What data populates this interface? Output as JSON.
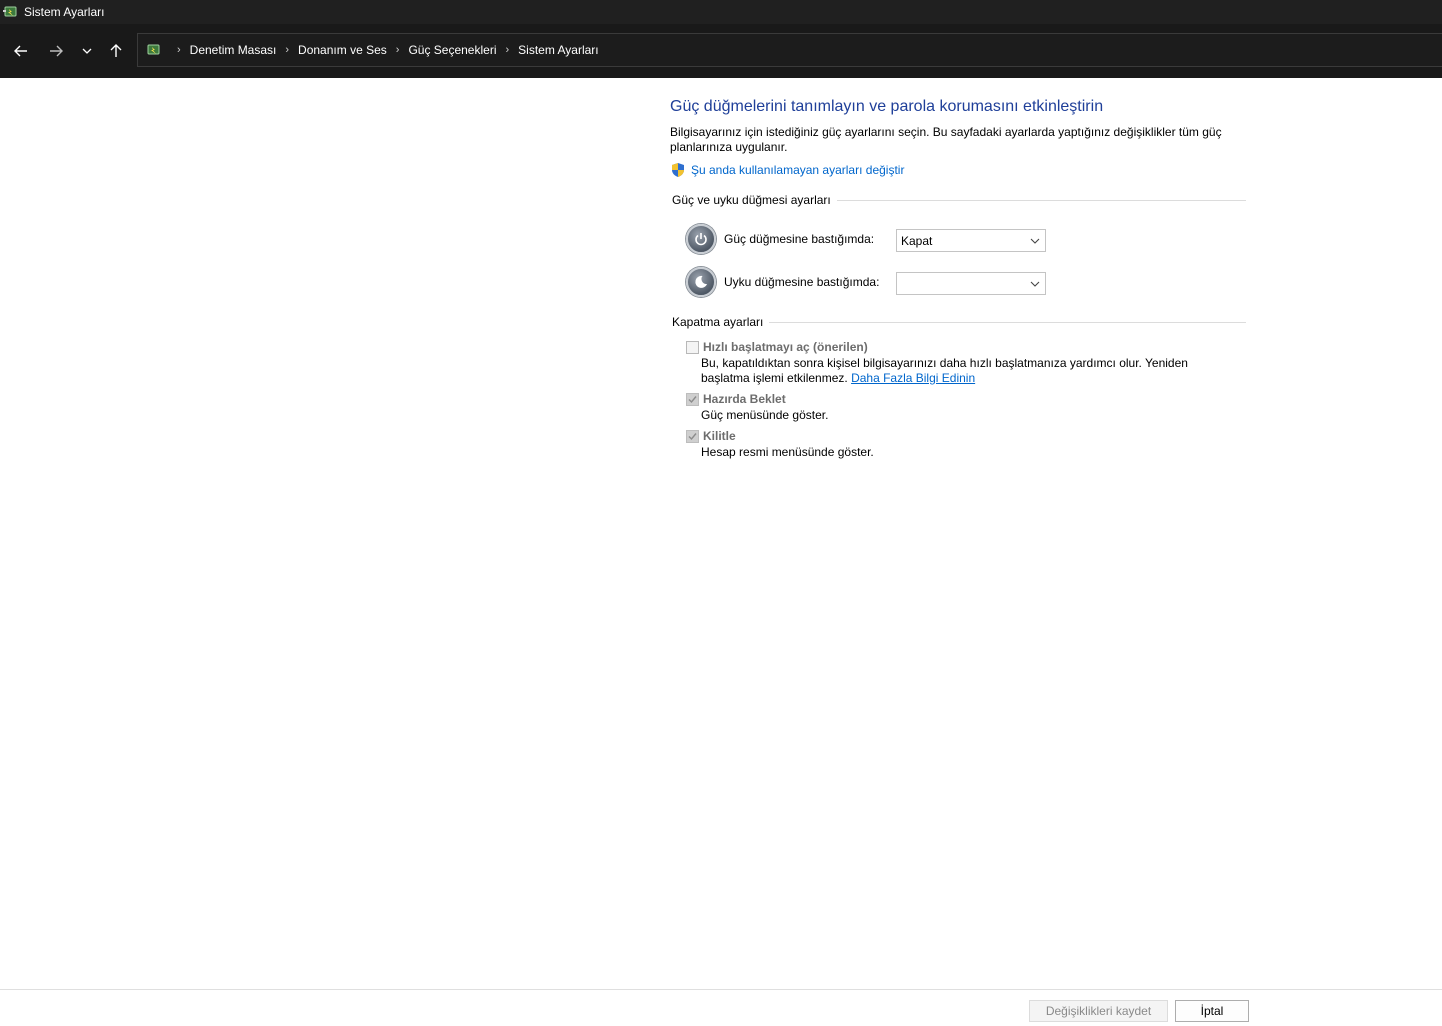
{
  "window": {
    "title": "Sistem Ayarları",
    "icon": "power-options-icon"
  },
  "nav": {
    "back_icon": "arrow-left-icon",
    "forward_icon": "arrow-right-icon",
    "recent_icon": "chevron-down-icon",
    "up_icon": "arrow-up-icon",
    "breadcrumbs": [
      "Denetim Masası",
      "Donanım ve Ses",
      "Güç Seçenekleri",
      "Sistem Ayarları"
    ]
  },
  "main": {
    "title": "Güç düğmelerini tanımlayın ve parola korumasını etkinleştirin",
    "description": "Bilgisayarınız için istediğiniz güç ayarlarını seçin. Bu sayfadaki ayarlarda yaptığınız değişiklikler tüm güç planlarınıza uygulanır.",
    "change_link": "Şu anda kullanılamayan ayarları değiştir",
    "power_group": {
      "header": "Güç ve uyku düğmesi ayarları",
      "power_button_label": "Güç düğmesine bastığımda:",
      "power_button_value": "Kapat",
      "sleep_button_label": "Uyku düğmesine bastığımda:",
      "sleep_button_value": ""
    },
    "shutdown_group": {
      "header": "Kapatma ayarları",
      "fast_startup": {
        "label": "Hızlı başlatmayı aç (önerilen)",
        "checked": false,
        "description": "Bu, kapatıldıktan sonra kişisel bilgisayarınızı daha hızlı başlatmanıza yardımcı olur. Yeniden başlatma işlemi etkilenmez.",
        "link": "Daha Fazla Bilgi Edinin"
      },
      "hibernate": {
        "label": "Hazırda Beklet",
        "checked": true,
        "description": "Güç menüsünde göster."
      },
      "lock": {
        "label": "Kilitle",
        "checked": true,
        "description": "Hesap resmi menüsünde göster."
      }
    }
  },
  "footer": {
    "save_label": "Değişiklikleri kaydet",
    "cancel_label": "İptal"
  },
  "colors": {
    "title_blue": "#1f3f99",
    "link_blue": "#0066cc",
    "titlebar_bg": "#202020",
    "navbar_bg": "#191919"
  }
}
